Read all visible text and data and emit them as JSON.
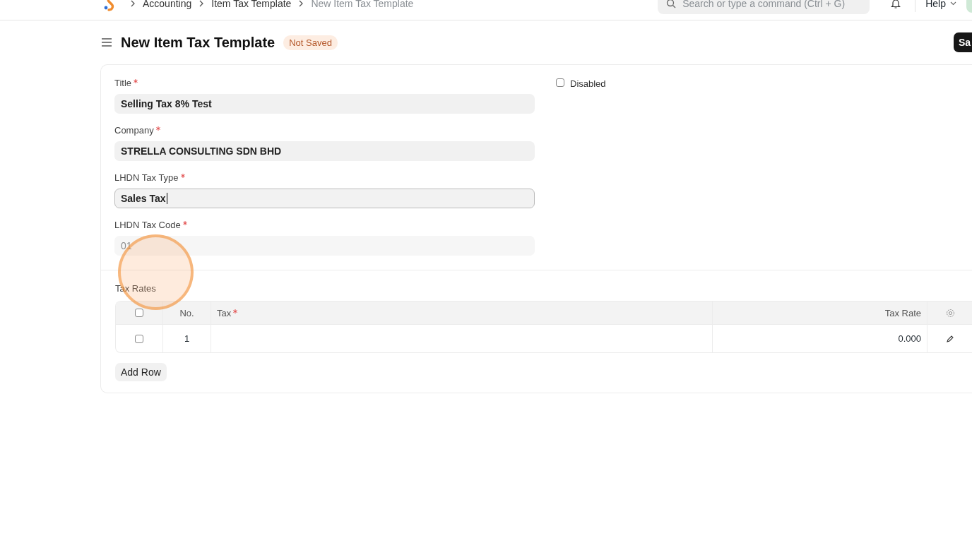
{
  "navbar": {
    "breadcrumbs": [
      {
        "label": "Accounting",
        "current": false
      },
      {
        "label": "Item Tax Template",
        "current": false
      },
      {
        "label": "New Item Tax Template",
        "current": true
      }
    ],
    "search": {
      "placeholder": "Search or type a command (Ctrl + G)"
    },
    "help": "Help"
  },
  "page": {
    "title": "New Item Tax Template",
    "status": "Not Saved",
    "save_button": "Sa"
  },
  "form": {
    "fields": [
      {
        "label": "Title",
        "required": true,
        "value": "Selling Tax 8% Test",
        "focused": false,
        "read_only": false
      },
      {
        "label": "Company",
        "required": true,
        "value": "STRELLA CONSULTING SDN BHD",
        "focused": false,
        "read_only": false
      },
      {
        "label": "LHDN Tax Type",
        "required": true,
        "value": "Sales Tax",
        "focused": true,
        "read_only": false
      },
      {
        "label": "LHDN Tax Code",
        "required": true,
        "value": "01",
        "focused": false,
        "read_only": true
      }
    ],
    "disabled": {
      "label": "Disabled",
      "checked": false
    }
  },
  "tax_rates": {
    "label": "Tax Rates",
    "header_checked": false,
    "columns": [
      {
        "label": "No.",
        "required": false
      },
      {
        "label": "Tax",
        "required": true
      },
      {
        "label": "Tax Rate",
        "required": false
      }
    ],
    "rows": [
      {
        "no": "1",
        "tax_rate": "0.000",
        "selected": false
      }
    ],
    "add_row": "Add Row"
  }
}
